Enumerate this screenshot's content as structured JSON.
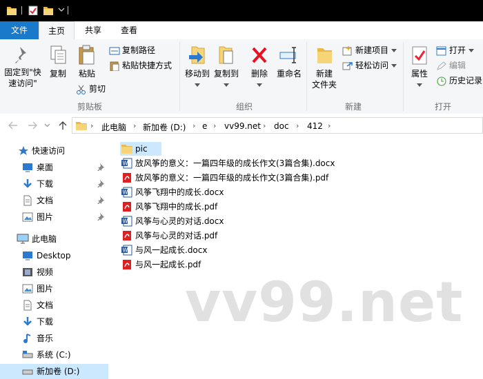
{
  "menubar": {
    "tabs": [
      {
        "label": "文件"
      },
      {
        "label": "主页"
      },
      {
        "label": "共享"
      },
      {
        "label": "查看"
      }
    ]
  },
  "ribbon": {
    "clipboard": {
      "pin_label": "固定到\"快速访问\"",
      "copy_label": "复制",
      "paste_label": "粘贴",
      "copy_path_label": "复制路径",
      "paste_shortcut_label": "粘贴快捷方式",
      "cut_label": "剪切",
      "group_label": "剪贴板"
    },
    "organize": {
      "move_to_label": "移动到",
      "copy_to_label": "复制到",
      "delete_label": "删除",
      "rename_label": "重命名",
      "group_label": "组织"
    },
    "new": {
      "new_folder_label": "新建\n文件夹",
      "new_item_label": "新建项目",
      "easy_access_label": "轻松访问",
      "group_label": "新建"
    },
    "open": {
      "properties_label": "属性",
      "open_label": "打开",
      "edit_label": "编辑",
      "history_label": "历史记录",
      "group_label": "打开"
    }
  },
  "address": {
    "crumbs": [
      "此电脑",
      "新加卷 (D:)",
      "e",
      "vv99.net",
      "doc",
      "412"
    ]
  },
  "nav": {
    "items": [
      {
        "label": "快速访问",
        "icon": "star-icon",
        "pinned": false
      },
      {
        "label": "桌面",
        "icon": "desktop-icon",
        "pinned": true
      },
      {
        "label": "下载",
        "icon": "download-icon",
        "pinned": true
      },
      {
        "label": "文档",
        "icon": "document-icon",
        "pinned": true
      },
      {
        "label": "图片",
        "icon": "picture-icon",
        "pinned": true
      },
      {
        "label": "此电脑",
        "icon": "computer-icon",
        "pinned": false
      },
      {
        "label": "Desktop",
        "icon": "desktop-icon",
        "pinned": false
      },
      {
        "label": "视频",
        "icon": "video-icon",
        "pinned": false
      },
      {
        "label": "图片",
        "icon": "picture-icon",
        "pinned": false
      },
      {
        "label": "文档",
        "icon": "document-icon",
        "pinned": false
      },
      {
        "label": "下载",
        "icon": "download-icon",
        "pinned": false
      },
      {
        "label": "音乐",
        "icon": "music-icon",
        "pinned": false
      },
      {
        "label": "系统 (C:)",
        "icon": "drive-icon",
        "pinned": false
      },
      {
        "label": "新加卷 (D:)",
        "icon": "drive-icon",
        "pinned": false
      }
    ]
  },
  "files": [
    {
      "name": "pic",
      "type": "folder"
    },
    {
      "name": "放风筝的意义：一篇四年级的成长作文(3篇合集).docx",
      "type": "docx"
    },
    {
      "name": "放风筝的意义：一篇四年级的成长作文(3篇合集).pdf",
      "type": "pdf"
    },
    {
      "name": "风筝飞翔中的成长.docx",
      "type": "docx"
    },
    {
      "name": "风筝飞翔中的成长.pdf",
      "type": "pdf"
    },
    {
      "name": "风筝与心灵的对话.docx",
      "type": "docx"
    },
    {
      "name": "风筝与心灵的对话.pdf",
      "type": "pdf"
    },
    {
      "name": "与风一起成长.docx",
      "type": "docx"
    },
    {
      "name": "与风一起成长.pdf",
      "type": "pdf"
    }
  ],
  "watermark": "vv99.net",
  "colors": {
    "accent": "#1979ca",
    "selection": "#cce8ff",
    "delete_red": "#e81123"
  }
}
